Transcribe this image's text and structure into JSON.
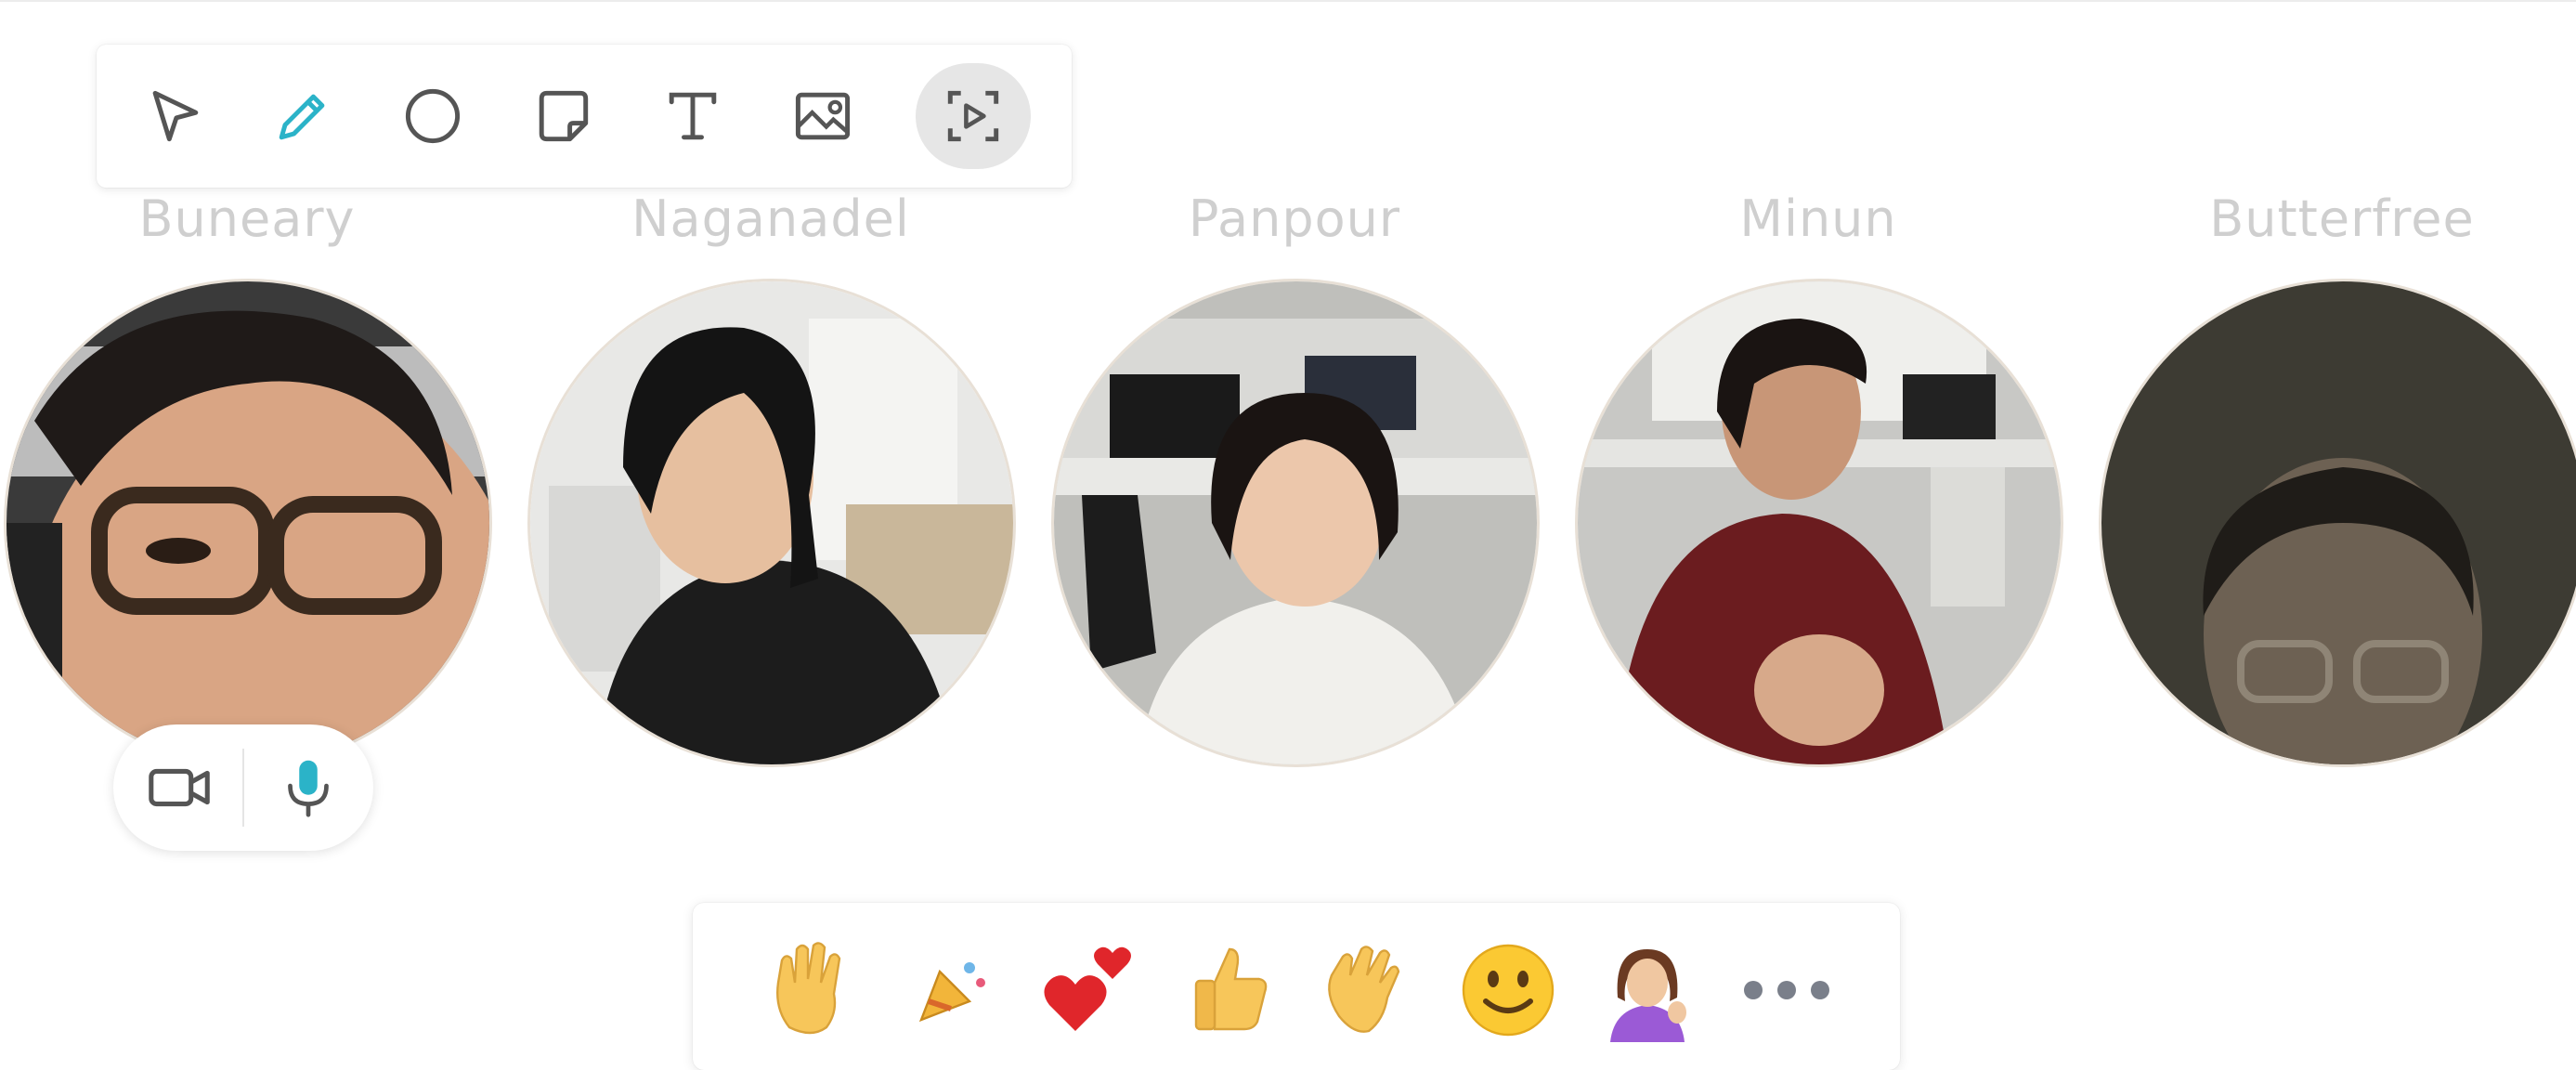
{
  "toolbar": {
    "tools": [
      {
        "name": "select-tool",
        "icon": "pointer-arrow-icon"
      },
      {
        "name": "pen-tool",
        "icon": "pencil-icon",
        "color": "#2bb3c8"
      },
      {
        "name": "shape-tool",
        "icon": "circle-icon"
      },
      {
        "name": "sticky-note-tool",
        "icon": "sticky-note-icon"
      },
      {
        "name": "text-tool",
        "icon": "text-icon"
      },
      {
        "name": "image-tool",
        "icon": "image-icon"
      },
      {
        "name": "record-tool",
        "icon": "screen-record-icon"
      }
    ]
  },
  "participants": [
    {
      "name": "Buneary"
    },
    {
      "name": "Naganadel"
    },
    {
      "name": "Panpour"
    },
    {
      "name": "Minun"
    },
    {
      "name": "Butterfree"
    }
  ],
  "media_controls": {
    "camera_icon": "video-camera-icon",
    "mic_icon": "microphone-icon"
  },
  "reactions": [
    {
      "icon": "raised-hand-icon"
    },
    {
      "icon": "party-popper-icon"
    },
    {
      "icon": "two-hearts-icon"
    },
    {
      "icon": "thumbs-up-icon"
    },
    {
      "icon": "waving-hand-icon"
    },
    {
      "icon": "smiling-face-icon"
    },
    {
      "icon": "woman-tipping-hand-icon"
    },
    {
      "icon": "more-options-icon"
    }
  ],
  "colors": {
    "accent": "#2bb3c8",
    "icon_gray": "#555555",
    "name_gray": "#cfcfcf"
  }
}
